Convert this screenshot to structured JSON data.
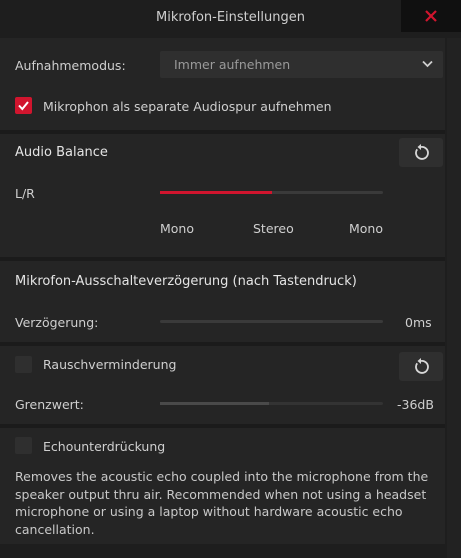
{
  "window": {
    "title": "Mikrofon-Einstellungen",
    "close_color": "#d1152e"
  },
  "recording_mode": {
    "label": "Aufnahmemodus:",
    "value": "Immer aufnehmen"
  },
  "separate_track": {
    "label": "Mikrophon als separate Audiospur aufnehmen",
    "checked": true
  },
  "audio_balance": {
    "heading": "Audio Balance",
    "channel_label": "L/R",
    "value_fraction": 0.5,
    "ticks": [
      "Mono",
      "Stereo",
      "Mono"
    ]
  },
  "mute_delay": {
    "heading": "Mikrofon-Ausschalteverzögerung (nach Tastendruck)",
    "delay_label": "Verzögerung:",
    "delay_value": "0ms",
    "fraction": 0
  },
  "noise_reduction": {
    "label": "Rauschverminderung",
    "checked": false,
    "threshold_label": "Grenzwert:",
    "threshold_value": "-36dB",
    "fraction": 0.5
  },
  "echo_cancel": {
    "label": "Echounterdrückung",
    "checked": false,
    "description": "Removes the acoustic echo coupled into the microphone from the speaker output thru air. Recommended when not using a headset microphone or using a laptop without hardware acoustic echo cancellation."
  },
  "colors": {
    "accent": "#d1152e",
    "panel": "#252525",
    "background": "#1e1e1e"
  }
}
